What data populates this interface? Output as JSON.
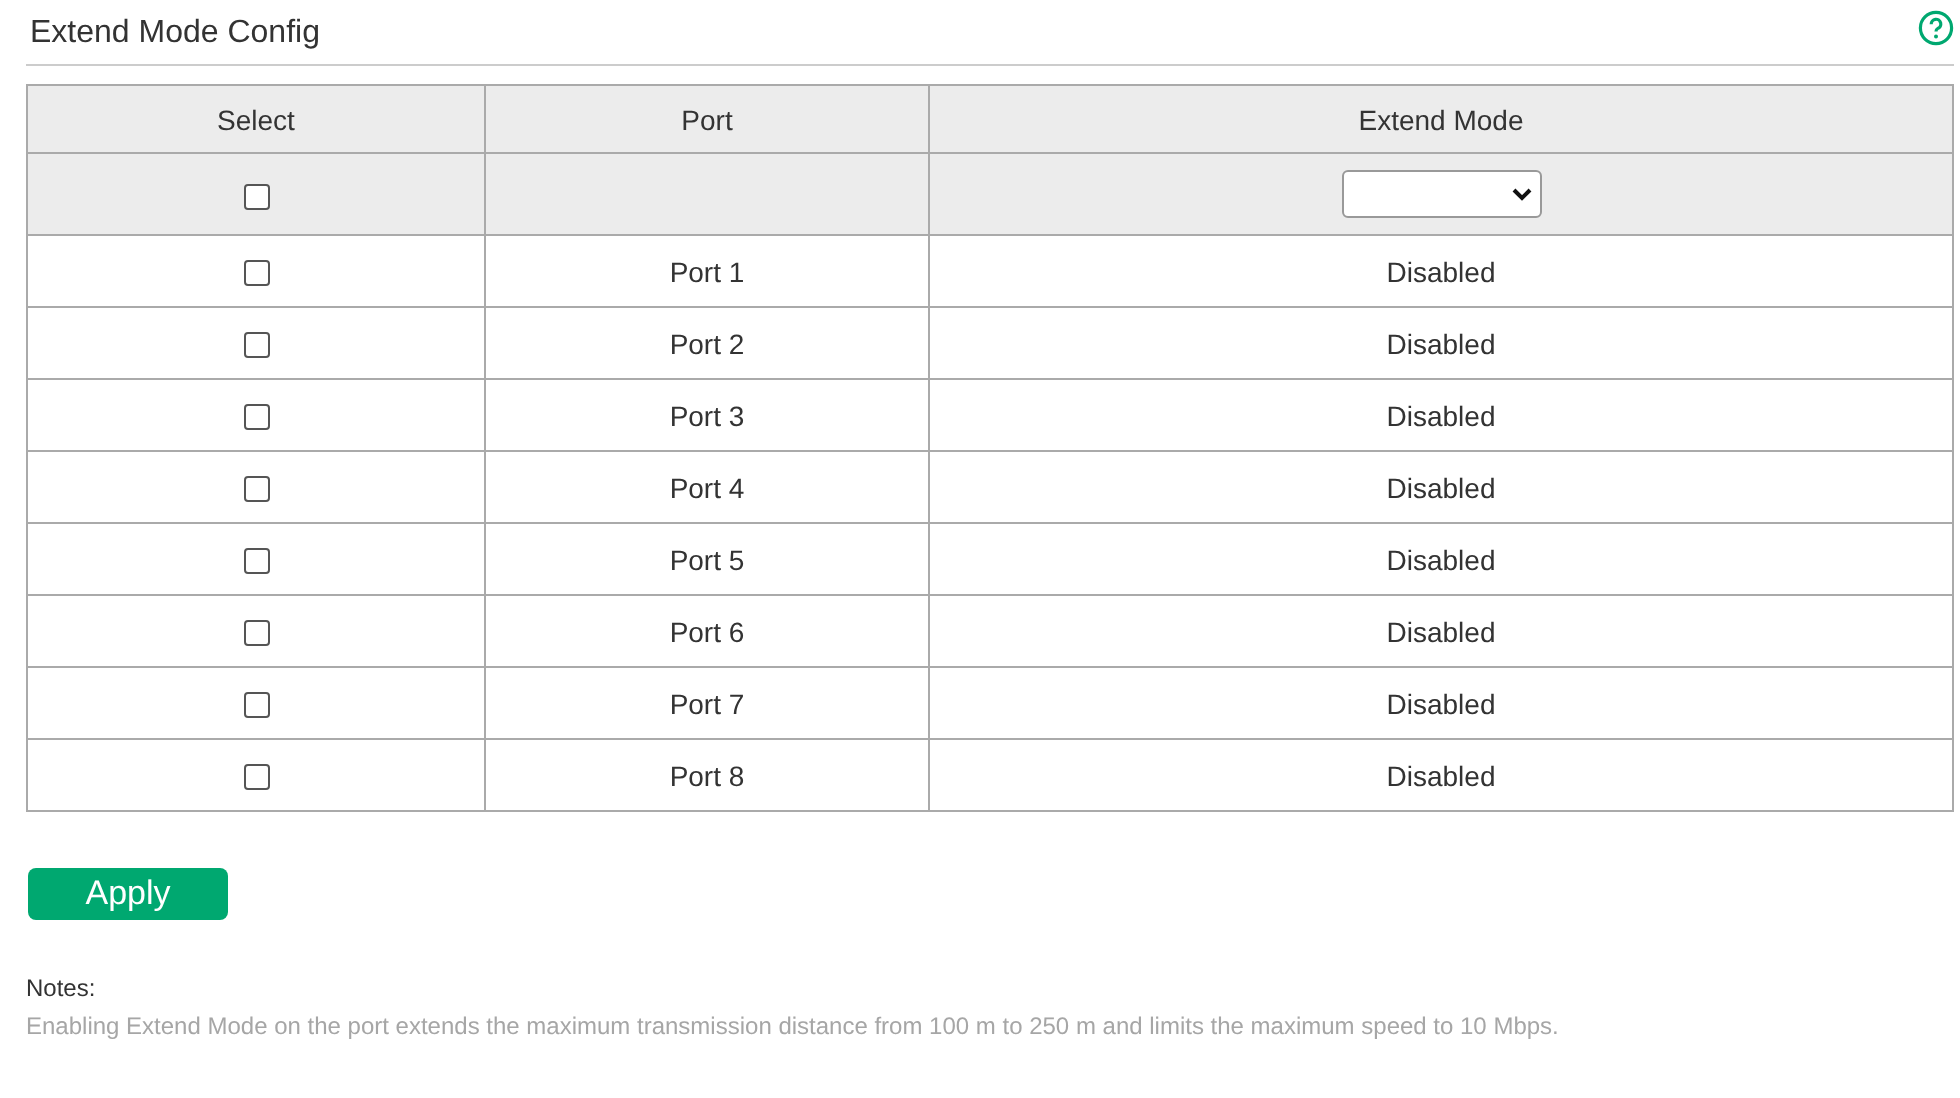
{
  "title": "Extend Mode Config",
  "table": {
    "columns": [
      "Select",
      "Port",
      "Extend Mode"
    ],
    "filter_row": {
      "checked": false
    },
    "rows": [
      {
        "port": "Port 1",
        "mode": "Disabled",
        "checked": false
      },
      {
        "port": "Port 2",
        "mode": "Disabled",
        "checked": false
      },
      {
        "port": "Port 3",
        "mode": "Disabled",
        "checked": false
      },
      {
        "port": "Port 4",
        "mode": "Disabled",
        "checked": false
      },
      {
        "port": "Port 5",
        "mode": "Disabled",
        "checked": false
      },
      {
        "port": "Port 6",
        "mode": "Disabled",
        "checked": false
      },
      {
        "port": "Port 7",
        "mode": "Disabled",
        "checked": false
      },
      {
        "port": "Port 8",
        "mode": "Disabled",
        "checked": false
      }
    ]
  },
  "apply_button": "Apply",
  "notes": {
    "label": "Notes:",
    "text": "Enabling Extend Mode on the port extends the maximum transmission distance from 100 m to 250 m and limits the maximum speed to 10 Mbps."
  }
}
